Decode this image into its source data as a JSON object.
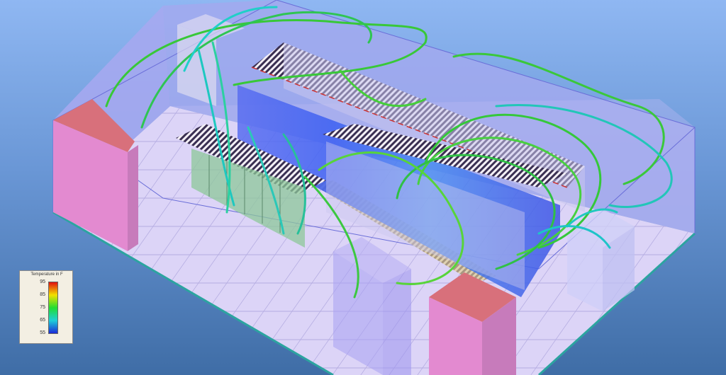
{
  "legend": {
    "title": "Temperature in F",
    "ticks": [
      "95",
      "85",
      "75",
      "65",
      "55"
    ]
  },
  "colors": {
    "c95": "#e01010",
    "c85": "#f2e100",
    "c75": "#22dd33",
    "c65": "#20cfd8",
    "c55": "#1a2ad8",
    "room_walls": "#9ea4ef",
    "floor": "#d8d0f6",
    "crac_pink": "#e38ad0",
    "crac_top": "#d8707b",
    "streamline": "#35c83a",
    "streamline_cool": "#1ec8c0"
  },
  "icons": [
    "room-enclosure",
    "server-rack-row",
    "perforated-tile-row",
    "crac-unit",
    "airflow-streamline"
  ]
}
